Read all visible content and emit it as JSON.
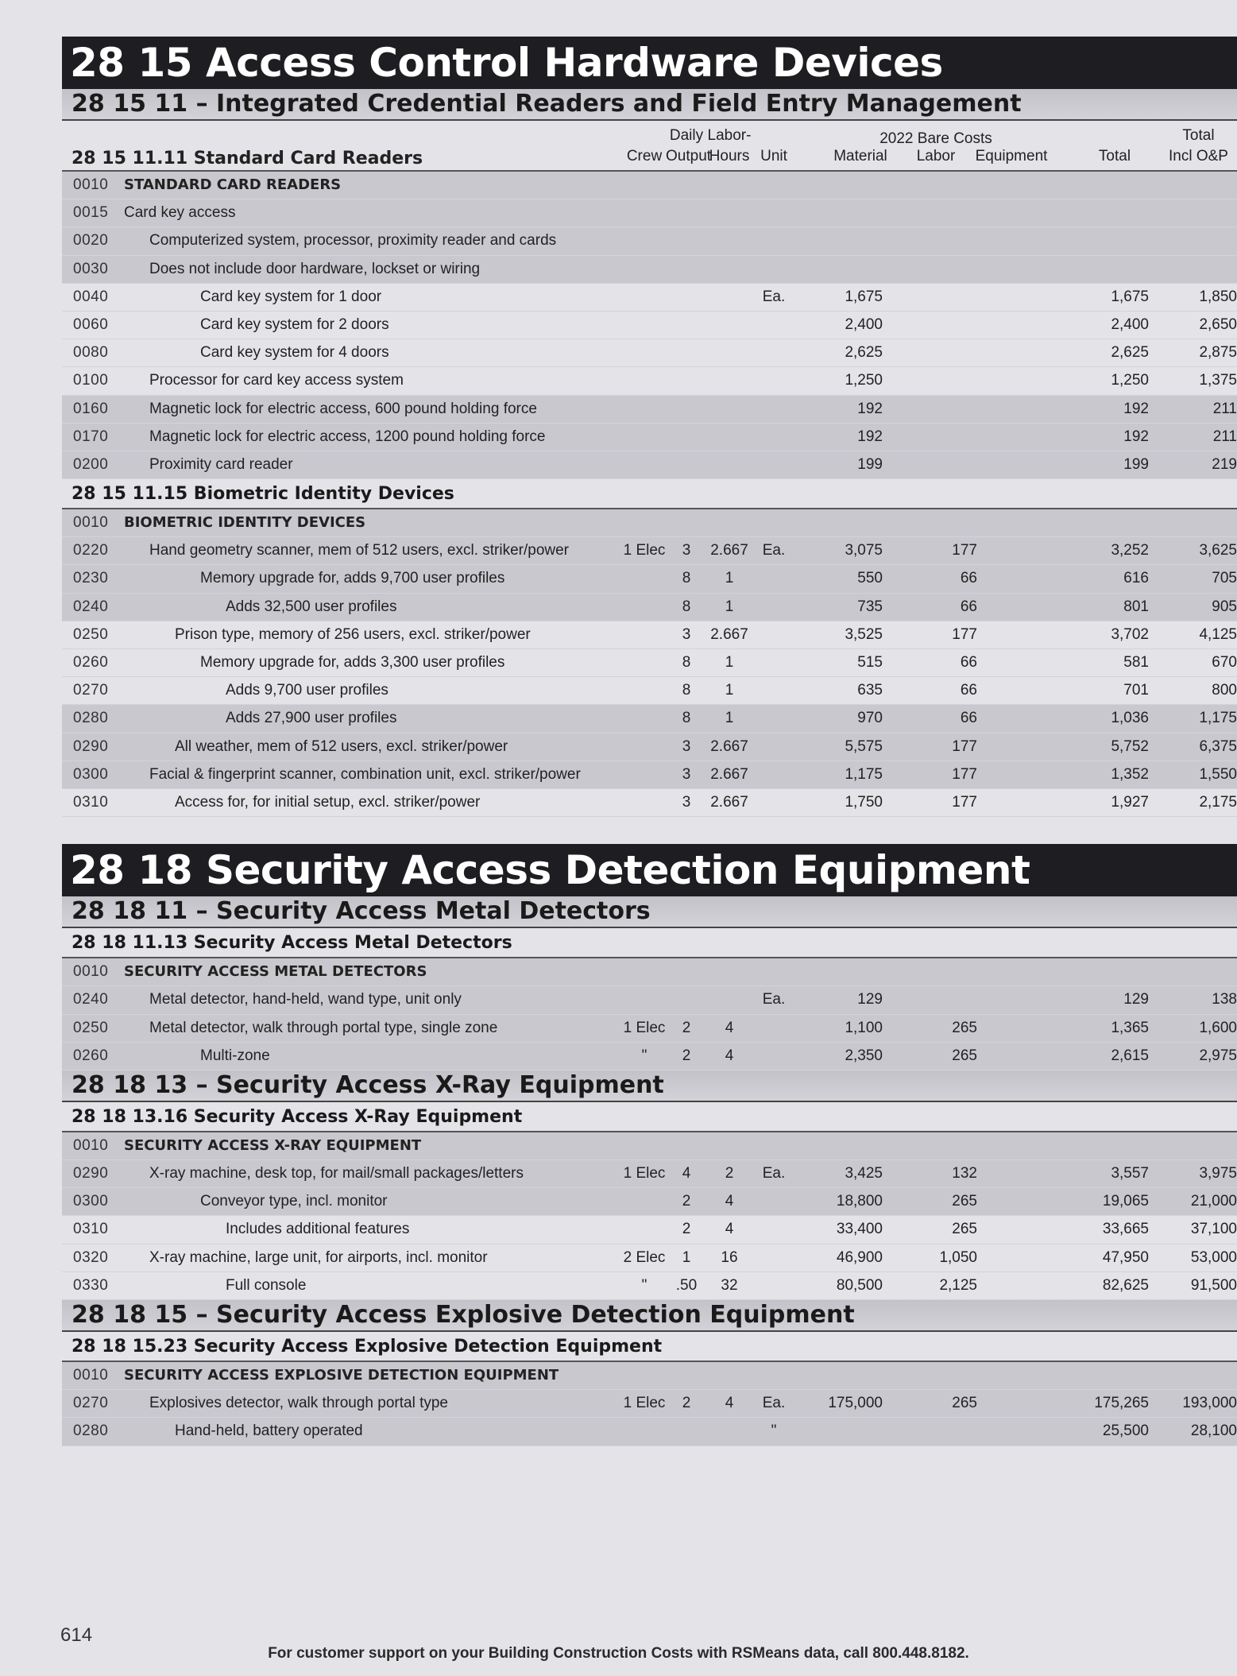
{
  "sections": [
    {
      "division_title": "28 15 Access Control Hardware Devices",
      "groups": [
        {
          "section_title": "28 15 11 – Integrated Credential Readers and Field Entry Management",
          "columns": {
            "crew": "Crew",
            "daily": "Daily",
            "output": "Output",
            "labor": "Labor-",
            "hours": "Hours",
            "unit": "Unit",
            "bare_costs": "2022 Bare Costs",
            "material": "Material",
            "labor_col": "Labor",
            "equipment": "Equipment",
            "total": "Total",
            "total_op_top": "Total",
            "total_op_bottom": "Incl O&P"
          },
          "subsections": [
            {
              "title": "28 15 11.11 Standard Card Readers",
              "rows": [
                {
                  "code": "0010",
                  "desc": "STANDARD CARD READERS",
                  "header": true
                },
                {
                  "code": "0015",
                  "desc": "Card key access",
                  "indent": 0
                },
                {
                  "code": "0020",
                  "desc": "Computerized system, processor, proximity reader and cards",
                  "indent": 1
                },
                {
                  "code": "0030",
                  "desc": "Does not include door hardware, lockset or wiring",
                  "indent": 1
                },
                {
                  "code": "0040",
                  "desc": "Card key system for 1 door",
                  "indent": 3,
                  "unit": "Ea.",
                  "material": "1,675",
                  "total": "1,675",
                  "op": "1,850"
                },
                {
                  "code": "0060",
                  "desc": "Card key system for 2 doors",
                  "indent": 3,
                  "material": "2,400",
                  "total": "2,400",
                  "op": "2,650"
                },
                {
                  "code": "0080",
                  "desc": "Card key system for 4 doors",
                  "indent": 3,
                  "material": "2,625",
                  "total": "2,625",
                  "op": "2,875"
                },
                {
                  "code": "0100",
                  "desc": "Processor for card key access system",
                  "indent": 1,
                  "material": "1,250",
                  "total": "1,250",
                  "op": "1,375"
                },
                {
                  "code": "0160",
                  "desc": "Magnetic lock for electric access, 600 pound holding force",
                  "indent": 1,
                  "material": "192",
                  "total": "192",
                  "op": "211"
                },
                {
                  "code": "0170",
                  "desc": "Magnetic lock for electric access, 1200 pound holding force",
                  "indent": 1,
                  "material": "192",
                  "total": "192",
                  "op": "211"
                },
                {
                  "code": "0200",
                  "desc": "Proximity card reader",
                  "indent": 1,
                  "material": "199",
                  "total": "199",
                  "op": "219"
                }
              ]
            },
            {
              "title": "28 15 11.15 Biometric Identity Devices",
              "rows": [
                {
                  "code": "0010",
                  "desc": "BIOMETRIC IDENTITY DEVICES",
                  "header": true
                },
                {
                  "code": "0220",
                  "desc": "Hand geometry scanner, mem of 512 users, excl. striker/power",
                  "indent": 1,
                  "crew": "1 Elec",
                  "output": "3",
                  "hours": "2.667",
                  "unit": "Ea.",
                  "material": "3,075",
                  "labor": "177",
                  "total": "3,252",
                  "op": "3,625"
                },
                {
                  "code": "0230",
                  "desc": "Memory upgrade for, adds 9,700 user profiles",
                  "indent": 3,
                  "output": "8",
                  "hours": "1",
                  "material": "550",
                  "labor": "66",
                  "total": "616",
                  "op": "705"
                },
                {
                  "code": "0240",
                  "desc": "Adds 32,500 user profiles",
                  "indent": 4,
                  "output": "8",
                  "hours": "1",
                  "material": "735",
                  "labor": "66",
                  "total": "801",
                  "op": "905"
                },
                {
                  "code": "0250",
                  "desc": "Prison type, memory of 256 users, excl. striker/power",
                  "indent": 2,
                  "output": "3",
                  "hours": "2.667",
                  "material": "3,525",
                  "labor": "177",
                  "total": "3,702",
                  "op": "4,125"
                },
                {
                  "code": "0260",
                  "desc": "Memory upgrade for, adds 3,300 user profiles",
                  "indent": 3,
                  "output": "8",
                  "hours": "1",
                  "material": "515",
                  "labor": "66",
                  "total": "581",
                  "op": "670"
                },
                {
                  "code": "0270",
                  "desc": "Adds 9,700 user profiles",
                  "indent": 4,
                  "output": "8",
                  "hours": "1",
                  "material": "635",
                  "labor": "66",
                  "total": "701",
                  "op": "800"
                },
                {
                  "code": "0280",
                  "desc": "Adds 27,900 user profiles",
                  "indent": 4,
                  "output": "8",
                  "hours": "1",
                  "material": "970",
                  "labor": "66",
                  "total": "1,036",
                  "op": "1,175"
                },
                {
                  "code": "0290",
                  "desc": "All weather, mem of 512 users, excl. striker/power",
                  "indent": 2,
                  "output": "3",
                  "hours": "2.667",
                  "material": "5,575",
                  "labor": "177",
                  "total": "5,752",
                  "op": "6,375"
                },
                {
                  "code": "0300",
                  "desc": "Facial & fingerprint scanner, combination unit, excl. striker/power",
                  "indent": 1,
                  "output": "3",
                  "hours": "2.667",
                  "material": "1,175",
                  "labor": "177",
                  "total": "1,352",
                  "op": "1,550"
                },
                {
                  "code": "0310",
                  "desc": "Access for, for initial setup, excl. striker/power",
                  "indent": 2,
                  "output": "3",
                  "hours": "2.667",
                  "material": "1,750",
                  "labor": "177",
                  "total": "1,927",
                  "op": "2,175"
                }
              ]
            }
          ]
        }
      ]
    },
    {
      "division_title": "28 18 Security Access Detection Equipment",
      "groups": [
        {
          "section_title": "28 18 11 – Security Access Metal Detectors",
          "subsections": [
            {
              "title": "28 18 11.13 Security Access Metal Detectors",
              "rows": [
                {
                  "code": "0010",
                  "desc": "SECURITY ACCESS METAL DETECTORS",
                  "header": true
                },
                {
                  "code": "0240",
                  "desc": "Metal detector, hand-held, wand type, unit only",
                  "indent": 1,
                  "unit": "Ea.",
                  "material": "129",
                  "total": "129",
                  "op": "138"
                },
                {
                  "code": "0250",
                  "desc": "Metal detector, walk through portal type, single zone",
                  "indent": 1,
                  "crew": "1 Elec",
                  "output": "2",
                  "hours": "4",
                  "material": "1,100",
                  "labor": "265",
                  "total": "1,365",
                  "op": "1,600"
                },
                {
                  "code": "0260",
                  "desc": "Multi-zone",
                  "indent": 3,
                  "crew": "\"",
                  "output": "2",
                  "hours": "4",
                  "material": "2,350",
                  "labor": "265",
                  "total": "2,615",
                  "op": "2,975"
                }
              ]
            }
          ]
        },
        {
          "section_title": "28 18 13 – Security Access X-Ray Equipment",
          "subsections": [
            {
              "title": "28 18 13.16 Security Access X-Ray Equipment",
              "rows": [
                {
                  "code": "0010",
                  "desc": "SECURITY ACCESS X-RAY EQUIPMENT",
                  "header": true
                },
                {
                  "code": "0290",
                  "desc": "X-ray machine, desk top, for mail/small packages/letters",
                  "indent": 1,
                  "crew": "1 Elec",
                  "output": "4",
                  "hours": "2",
                  "unit": "Ea.",
                  "material": "3,425",
                  "labor": "132",
                  "total": "3,557",
                  "op": "3,975"
                },
                {
                  "code": "0300",
                  "desc": "Conveyor type, incl. monitor",
                  "indent": 3,
                  "output": "2",
                  "hours": "4",
                  "material": "18,800",
                  "labor": "265",
                  "total": "19,065",
                  "op": "21,000"
                },
                {
                  "code": "0310",
                  "desc": "Includes additional features",
                  "indent": 4,
                  "output": "2",
                  "hours": "4",
                  "material": "33,400",
                  "labor": "265",
                  "total": "33,665",
                  "op": "37,100"
                },
                {
                  "code": "0320",
                  "desc": "X-ray machine, large unit, for airports, incl. monitor",
                  "indent": 1,
                  "crew": "2 Elec",
                  "output": "1",
                  "hours": "16",
                  "material": "46,900",
                  "labor": "1,050",
                  "total": "47,950",
                  "op": "53,000"
                },
                {
                  "code": "0330",
                  "desc": "Full console",
                  "indent": 4,
                  "crew": "\"",
                  "output": ".50",
                  "hours": "32",
                  "material": "80,500",
                  "labor": "2,125",
                  "total": "82,625",
                  "op": "91,500"
                }
              ]
            }
          ]
        },
        {
          "section_title": "28 18 15 – Security Access Explosive Detection Equipment",
          "subsections": [
            {
              "title": "28 18 15.23 Security Access Explosive Detection Equipment",
              "rows": [
                {
                  "code": "0010",
                  "desc": "SECURITY ACCESS EXPLOSIVE DETECTION EQUIPMENT",
                  "header": true
                },
                {
                  "code": "0270",
                  "desc": "Explosives detector, walk through portal type",
                  "indent": 1,
                  "crew": "1 Elec",
                  "output": "2",
                  "hours": "4",
                  "unit": "Ea.",
                  "material": "175,000",
                  "labor": "265",
                  "total": "175,265",
                  "op": "193,000"
                },
                {
                  "code": "0280",
                  "desc": "Hand-held, battery operated",
                  "indent": 2,
                  "unit": "\"",
                  "total": "25,500",
                  "op": "28,100"
                }
              ]
            }
          ]
        }
      ]
    }
  ],
  "page_number": "614",
  "footer": "For customer support on your Building Construction Costs with RSMeans data, call 800.448.8182."
}
